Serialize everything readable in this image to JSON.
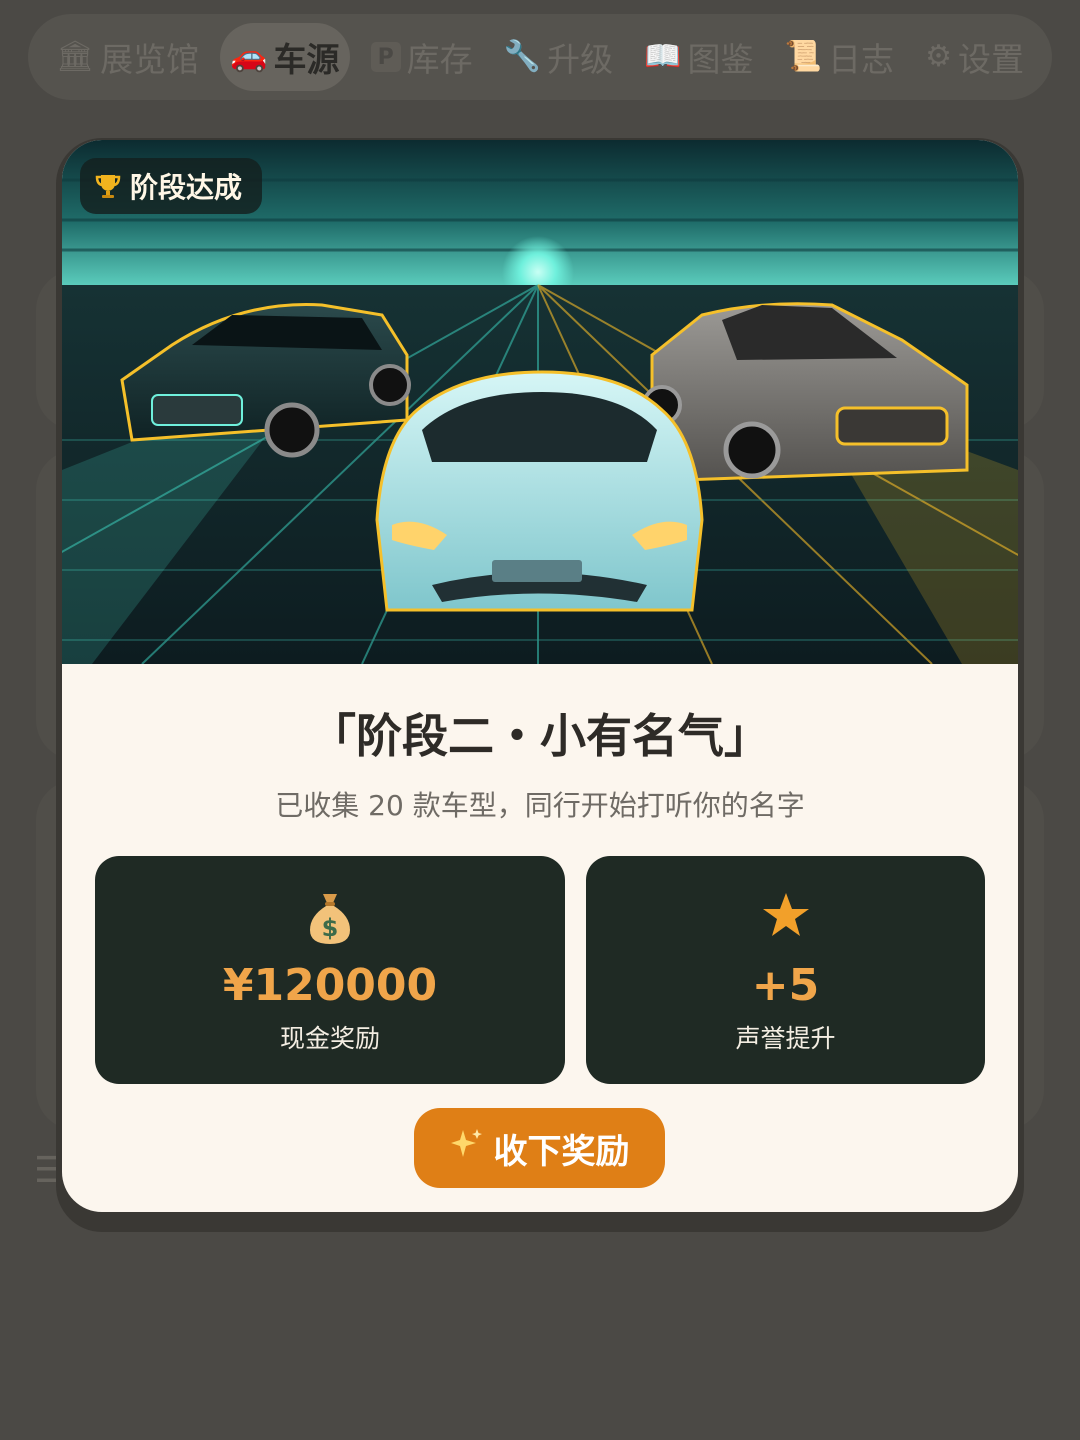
{
  "nav": {
    "items": [
      {
        "icon": "museum-icon",
        "glyph": "🏛",
        "label": "展览馆"
      },
      {
        "icon": "car-icon",
        "glyph": "🚗",
        "label": "车源"
      },
      {
        "icon": "parking-icon",
        "glyph": "P",
        "label": "库存"
      },
      {
        "icon": "wrench-icon",
        "glyph": "🔧",
        "label": "升级"
      },
      {
        "icon": "book-icon",
        "glyph": "📖",
        "label": "图鉴"
      },
      {
        "icon": "scroll-icon",
        "glyph": "📜",
        "label": "日志"
      },
      {
        "icon": "gear-icon",
        "glyph": "⚙",
        "label": "设置"
      }
    ],
    "active": "车源"
  },
  "modal": {
    "badge": {
      "icon": "trophy-icon",
      "label": "阶段达成"
    },
    "title": "「阶段二・小有名气」",
    "subtitle": "已收集 20 款车型，同行开始打听你的名字",
    "rewards": {
      "cash": {
        "icon": "money-bag-icon",
        "value": "¥120000",
        "label": "现金奖励"
      },
      "reputation": {
        "icon": "star-icon",
        "value": "+5",
        "label": "声誉提升"
      }
    },
    "collect_button": {
      "icon": "sparkles-icon",
      "label": "收下奖励"
    }
  },
  "colors": {
    "backdrop": "#4b4945",
    "modal_bg": "#fcf6ee",
    "reward_card": "#1f2a24",
    "reward_value": "#f0a54a",
    "button": "#df7f16",
    "hero_glow_cyan": "#4fe0d0",
    "hero_glow_gold": "#f5c02a"
  }
}
